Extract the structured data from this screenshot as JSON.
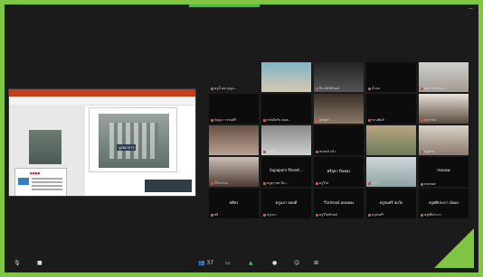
{
  "window": {
    "top_right": "—"
  },
  "toolbar": [
    {
      "icon": "mic-icon",
      "glyph": "🎙",
      "label": ""
    },
    {
      "icon": "video-icon",
      "glyph": "■",
      "label": ""
    },
    {
      "icon": "participants-icon",
      "glyph": "👥 37",
      "label": ""
    },
    {
      "icon": "chat-icon",
      "glyph": "▭",
      "label": ""
    },
    {
      "icon": "share-screen-icon",
      "glyph": "▲",
      "label": ""
    },
    {
      "icon": "record-icon",
      "glyph": "●",
      "label": ""
    },
    {
      "icon": "reactions-icon",
      "glyph": "☺",
      "label": ""
    },
    {
      "icon": "apps-icon",
      "glyph": "⊞",
      "label": ""
    }
  ],
  "slide": {
    "caption": "บูรณาการ"
  },
  "tiles": [
    {
      "label": "ครูน้ำฝน บุญม...",
      "name": "",
      "active": true
    },
    {
      "label": "",
      "name": ""
    },
    {
      "label": "ปิ่น บัตร์ลักษณ์",
      "name": ""
    },
    {
      "label": "น้ำฝน",
      "name": ""
    },
    {
      "label": "ครูดารัตน์ บุญ...",
      "name": ""
    },
    {
      "label": "กัญญา วรรณสิริ",
      "name": ""
    },
    {
      "label": "หวัดดีครับ สมศ...",
      "name": ""
    },
    {
      "label": "สุนันทา",
      "name": ""
    },
    {
      "label": "ชวนพิมพ์",
      "name": ""
    },
    {
      "label": "ครูวรรณ",
      "name": ""
    },
    {
      "label": "",
      "name": ""
    },
    {
      "label": "ครูศศิ",
      "name": ""
    },
    {
      "label": "สมพงษ์ แก้ว",
      "name": ""
    },
    {
      "label": "",
      "name": ""
    },
    {
      "label": "ครูจิตรา",
      "name": ""
    },
    {
      "label": "วิไลวรรณ",
      "name": ""
    },
    {
      "label": "ครูสุภาพร ปิ่น...",
      "name": "Supaporn Pinnet..."
    },
    {
      "label": "ครูวิไล",
      "name": "ศรีสุดา ปิ่นทอง"
    },
    {
      "label": "อุไร",
      "name": ""
    },
    {
      "label": "manaw",
      "name": "manaw"
    },
    {
      "label": "ศศิ",
      "name": "ศศิธร"
    },
    {
      "label": "ครูนภา",
      "name": "ครูนภา ยอดดี"
    },
    {
      "label": "ครูวิไลลักษณ์",
      "name": "วิไลลักษณ์ อ่อนทอง"
    },
    {
      "label": "ครูสมศรี",
      "name": "ครูสมศรี สมใจ"
    },
    {
      "label": "ครูศศิประภา",
      "name": "ครูศศิประภา มั่นคง"
    }
  ]
}
